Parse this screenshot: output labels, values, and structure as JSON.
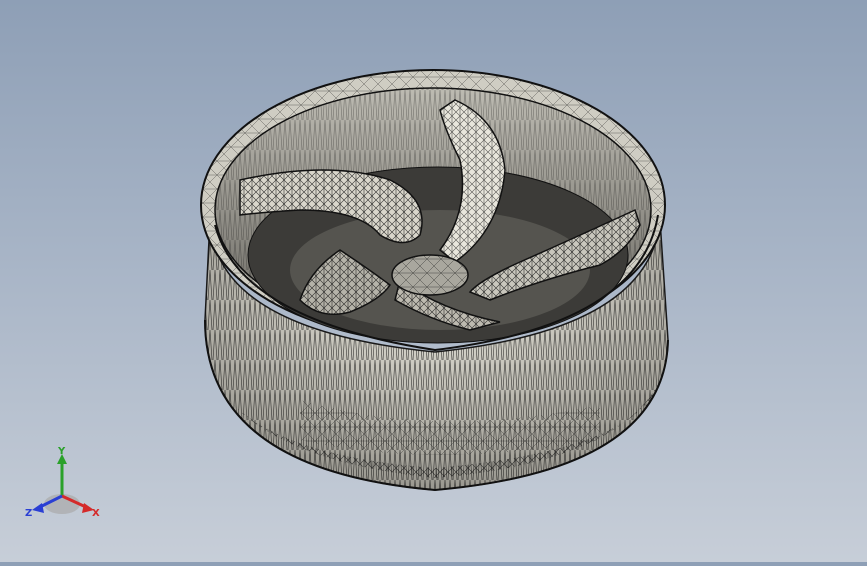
{
  "viewport": {
    "model": "wheel-rim-mesh",
    "mesh_color": "#1a1a1a",
    "surface_color": "#d8d6cc",
    "background_top": "#8e9fb6",
    "background_bottom": "#c7ced8"
  },
  "triad": {
    "x_label": "X",
    "y_label": "Y",
    "z_label": "Z",
    "x_color": "#d42a2a",
    "y_color": "#2aa12a",
    "z_color": "#2a3fd4"
  }
}
